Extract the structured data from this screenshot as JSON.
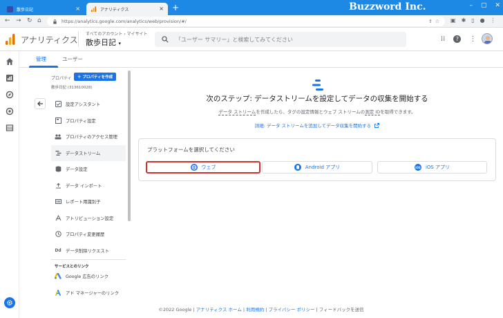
{
  "browser": {
    "tabs": [
      {
        "title": "散歩日記",
        "active": false
      },
      {
        "title": "アナリティクス",
        "active": true
      }
    ],
    "url": "https://analytics.google.com/analytics/web/provision/#/",
    "watermark": "Buzzword Inc."
  },
  "header": {
    "app_title": "アナリティクス",
    "breadcrumb": "すべてのアカウント › マイサイト",
    "property_name": "散歩日記",
    "search_placeholder": "「ユーザー サマリー」と検索してみてください"
  },
  "admin_tabs": [
    {
      "label": "管理",
      "active": true
    },
    {
      "label": "ユーザー",
      "active": false
    }
  ],
  "panel": {
    "property_label": "プロパティ",
    "create_property_label": "＋ プロパティを作成",
    "property_id": "散歩日記 (313610028)",
    "menu": [
      {
        "label": "設定アシスタント",
        "icon": "checklist-icon"
      },
      {
        "label": "プロパティ設定",
        "icon": "property-settings-icon"
      },
      {
        "label": "プロパティのアクセス管理",
        "icon": "people-icon"
      },
      {
        "label": "データストリーム",
        "icon": "data-stream-icon",
        "selected": true
      },
      {
        "label": "データ設定",
        "icon": "database-icon"
      },
      {
        "label": "データ インポート",
        "icon": "upload-icon"
      },
      {
        "label": "レポート用識別子",
        "icon": "identifier-icon"
      },
      {
        "label": "アトリビューション設定",
        "icon": "attribution-icon"
      },
      {
        "label": "プロパティ変更履歴",
        "icon": "history-icon"
      },
      {
        "label": "データ削除リクエスト",
        "icon": "dd-icon"
      }
    ],
    "links_heading": "サービスとのリンク",
    "links": [
      {
        "label": "Google 広告のリンク",
        "icon": "google-ads-icon"
      },
      {
        "label": "アド マネージャーのリンク",
        "icon": "ad-manager-icon"
      }
    ]
  },
  "main": {
    "title": "次のステップ: データストリームを設定してデータの収集を開始する",
    "desc_part1": "データ ストリーム",
    "desc_part2": "を作成したら、タグの設定情報とウェブ ストリームの",
    "desc_part3": "測定 ID",
    "desc_part4": "を取得できます。",
    "learn_link": "詳細: データ ストリームを追加してデータ収集を開始する",
    "platform_title": "プラットフォームを選択してください",
    "platforms": {
      "web": "ウェブ",
      "android": "Android アプリ",
      "ios": "iOS アプリ"
    }
  },
  "footer": {
    "copyright": "©2022 Google",
    "home": "アナリティクス ホーム",
    "terms": "利用規約",
    "privacy": "プライバシー ポリシー",
    "feedback": "フィードバックを送信"
  },
  "colors": {
    "accent": "#1a73e8",
    "chrome_tab_bar": "#1e88e5",
    "highlight_box": "#d32f2f"
  }
}
